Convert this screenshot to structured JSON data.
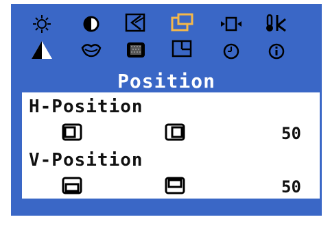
{
  "osd": {
    "background_color": "#3a67c6",
    "selected_color": "#f5b84a",
    "menu_title": "Position",
    "top_icons_row1": [
      "brightness-icon",
      "contrast-icon",
      "auto-adjust-icon",
      "position-icon",
      "zoom-icon",
      "temperature-icon"
    ],
    "top_icons_row2": [
      "sharpness-icon",
      "face-icon",
      "color-icon",
      "size-icon",
      "timer-icon",
      "info-icon"
    ],
    "selected_icon": "position-icon"
  },
  "settings": {
    "h_position": {
      "label": "H-Position",
      "value": "50",
      "decrease_icon": "h-position-left-icon",
      "increase_icon": "h-position-right-icon"
    },
    "v_position": {
      "label": "V-Position",
      "value": "50",
      "decrease_icon": "v-position-down-icon",
      "increase_icon": "v-position-up-icon"
    }
  }
}
